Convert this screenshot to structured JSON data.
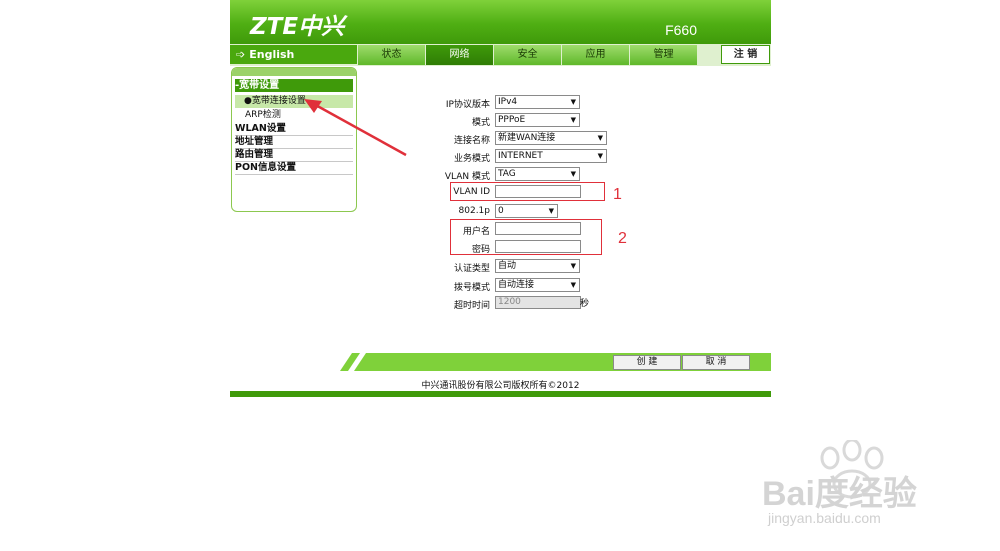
{
  "header": {
    "logo": "ZTE中兴",
    "model": "F660"
  },
  "nav": {
    "language": "English",
    "tabs": [
      "状态",
      "网络",
      "安全",
      "应用",
      "管理"
    ],
    "active_tab": "网络",
    "logout": "注 销"
  },
  "sidebar": {
    "group_title": "-宽带设置",
    "selected_item": "●宽带连接设置",
    "sub_item": "ARP检测",
    "sections": [
      "WLAN设置",
      "地址管理",
      "路由管理",
      "PON信息设置"
    ]
  },
  "form": {
    "ip_version": {
      "label": "IP协议版本",
      "value": "IPv4"
    },
    "mode": {
      "label": "模式",
      "value": "PPPoE"
    },
    "connection_name": {
      "label": "连接名称",
      "value": "新建WAN连接"
    },
    "service_mode": {
      "label": "业务模式",
      "value": "INTERNET"
    },
    "vlan_mode": {
      "label": "VLAN 模式",
      "value": "TAG"
    },
    "vlan_id": {
      "label": "VLAN ID",
      "value": ""
    },
    "priority": {
      "label": "802.1p",
      "value": "0"
    },
    "username": {
      "label": "用户名",
      "value": ""
    },
    "password": {
      "label": "密码",
      "value": ""
    },
    "auth_type": {
      "label": "认证类型",
      "value": "自动"
    },
    "dial_mode": {
      "label": "拨号模式",
      "value": "自动连接"
    },
    "timeout": {
      "label": "超时时间",
      "value": "1200",
      "unit": "秒"
    }
  },
  "annotations": {
    "marker1": "1",
    "marker2": "2",
    "color": "#e0303a"
  },
  "actions": {
    "create": "创 建",
    "cancel": "取 消"
  },
  "footer": {
    "copyright": "中兴通讯股份有限公司版权所有©2012"
  },
  "watermark": {
    "brand": "Bai度经验",
    "url": "jingyan.baidu.com"
  },
  "colors": {
    "brand_green": "#4fae13",
    "dark_green": "#3f9a0a",
    "light_green": "#7fd13a"
  }
}
